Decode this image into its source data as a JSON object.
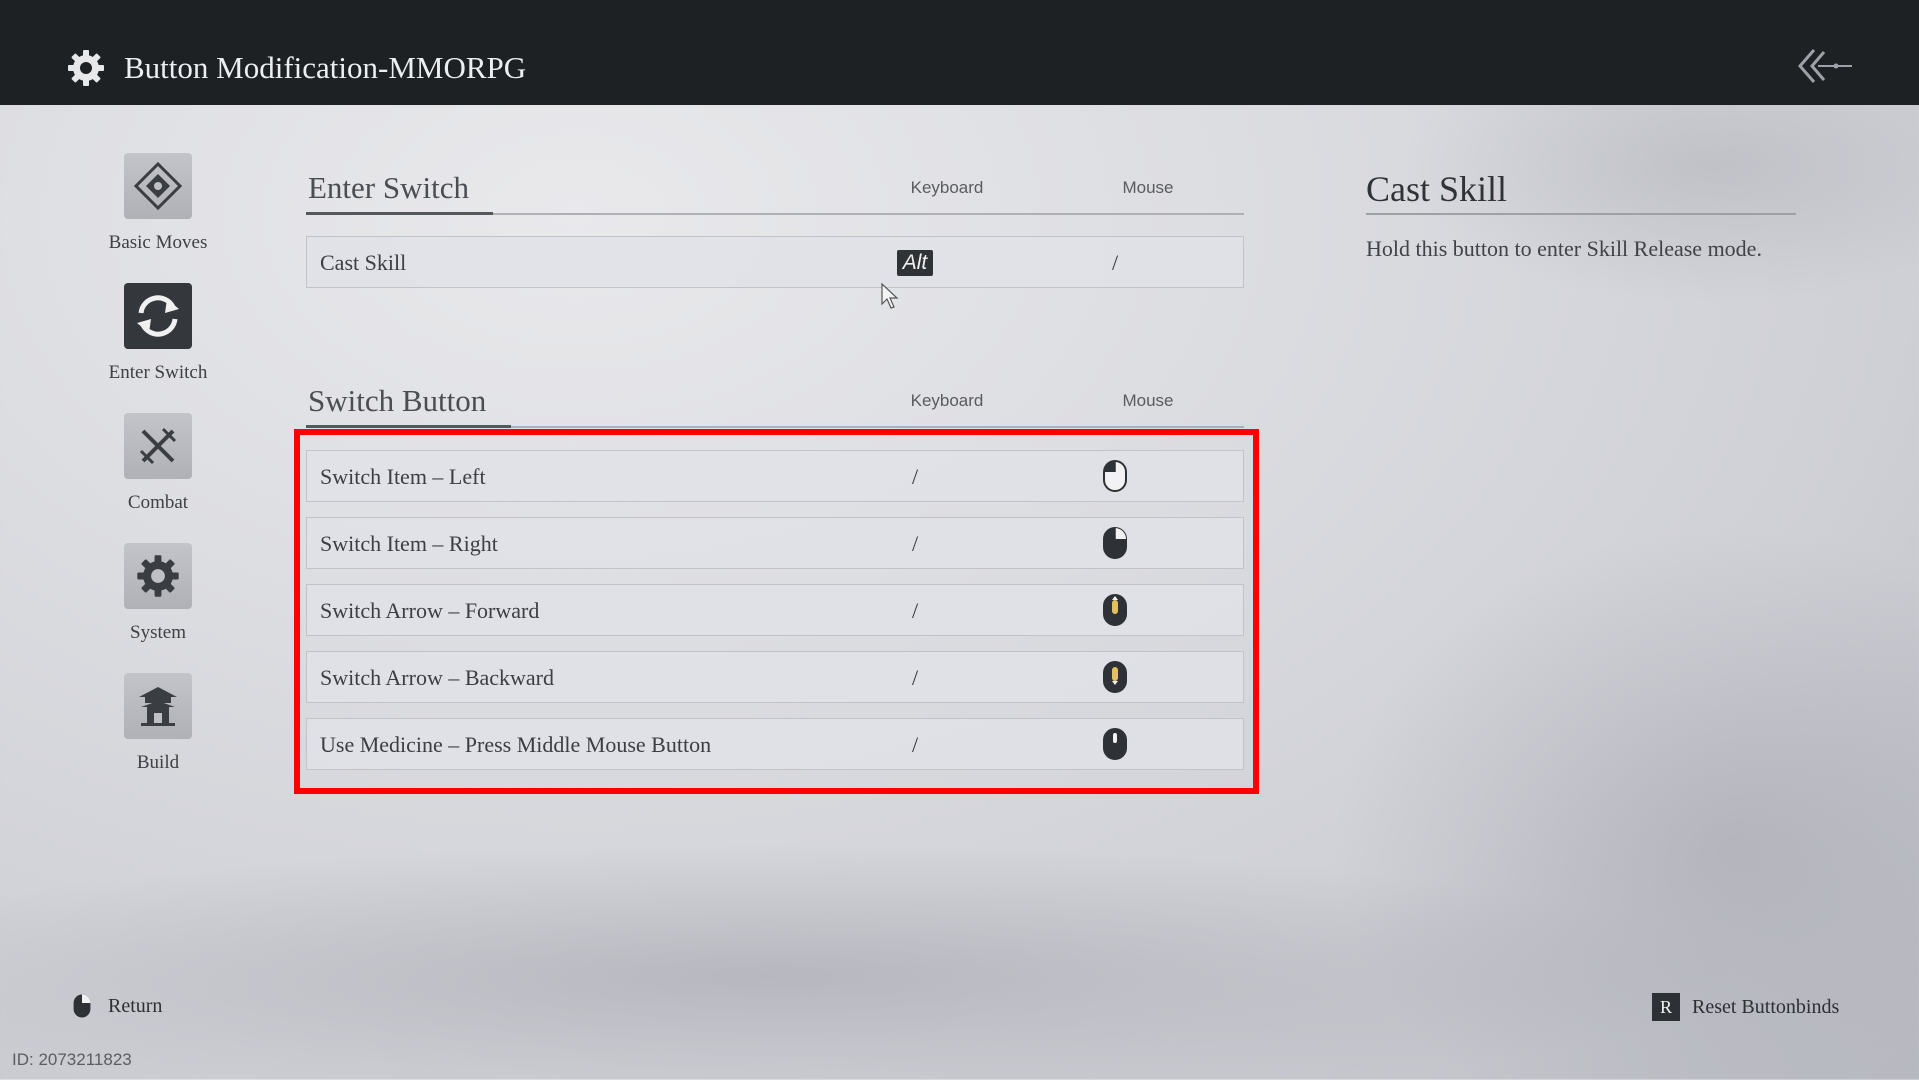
{
  "window": {
    "title": "Button Modification-MMORPG"
  },
  "sidebar": {
    "items": [
      {
        "label": "Basic Moves",
        "icon": "diamond-compass-icon",
        "active": false
      },
      {
        "label": "Enter Switch",
        "icon": "switch-arrows-icon",
        "active": true
      },
      {
        "label": "Combat",
        "icon": "crossed-swords-icon",
        "active": false
      },
      {
        "label": "System",
        "icon": "gear-icon",
        "active": false
      },
      {
        "label": "Build",
        "icon": "pagoda-icon",
        "active": false
      }
    ]
  },
  "sections": [
    {
      "title": "Enter Switch",
      "col_keyboard": "Keyboard",
      "col_mouse": "Mouse",
      "rows": [
        {
          "name": "Cast Skill",
          "keyboard": "Alt",
          "mouse": "/"
        }
      ]
    },
    {
      "title": "Switch Button",
      "col_keyboard": "Keyboard",
      "col_mouse": "Mouse",
      "rows": [
        {
          "name": "Switch Item – Left",
          "keyboard": "/",
          "mouse_icon": "mouse-left-click-icon"
        },
        {
          "name": "Switch Item – Right",
          "keyboard": "/",
          "mouse_icon": "mouse-right-click-icon"
        },
        {
          "name": "Switch Arrow – Forward",
          "keyboard": "/",
          "mouse_icon": "mouse-scroll-up-icon"
        },
        {
          "name": "Switch Arrow – Backward",
          "keyboard": "/",
          "mouse_icon": "mouse-scroll-down-icon"
        },
        {
          "name": "Use Medicine – Press Middle Mouse Button",
          "keyboard": "/",
          "mouse_icon": "mouse-middle-click-icon"
        }
      ]
    }
  ],
  "detail": {
    "title": "Cast Skill",
    "description": "Hold this button to enter Skill Release mode."
  },
  "footer": {
    "return_label": "Return",
    "reset_key": "R",
    "reset_label": "Reset Buttonbinds"
  },
  "watermark": "ID: 2073211823",
  "colors": {
    "highlight": "#ff0000",
    "topbar": "#1e2124",
    "active_tab": "#34373b"
  }
}
